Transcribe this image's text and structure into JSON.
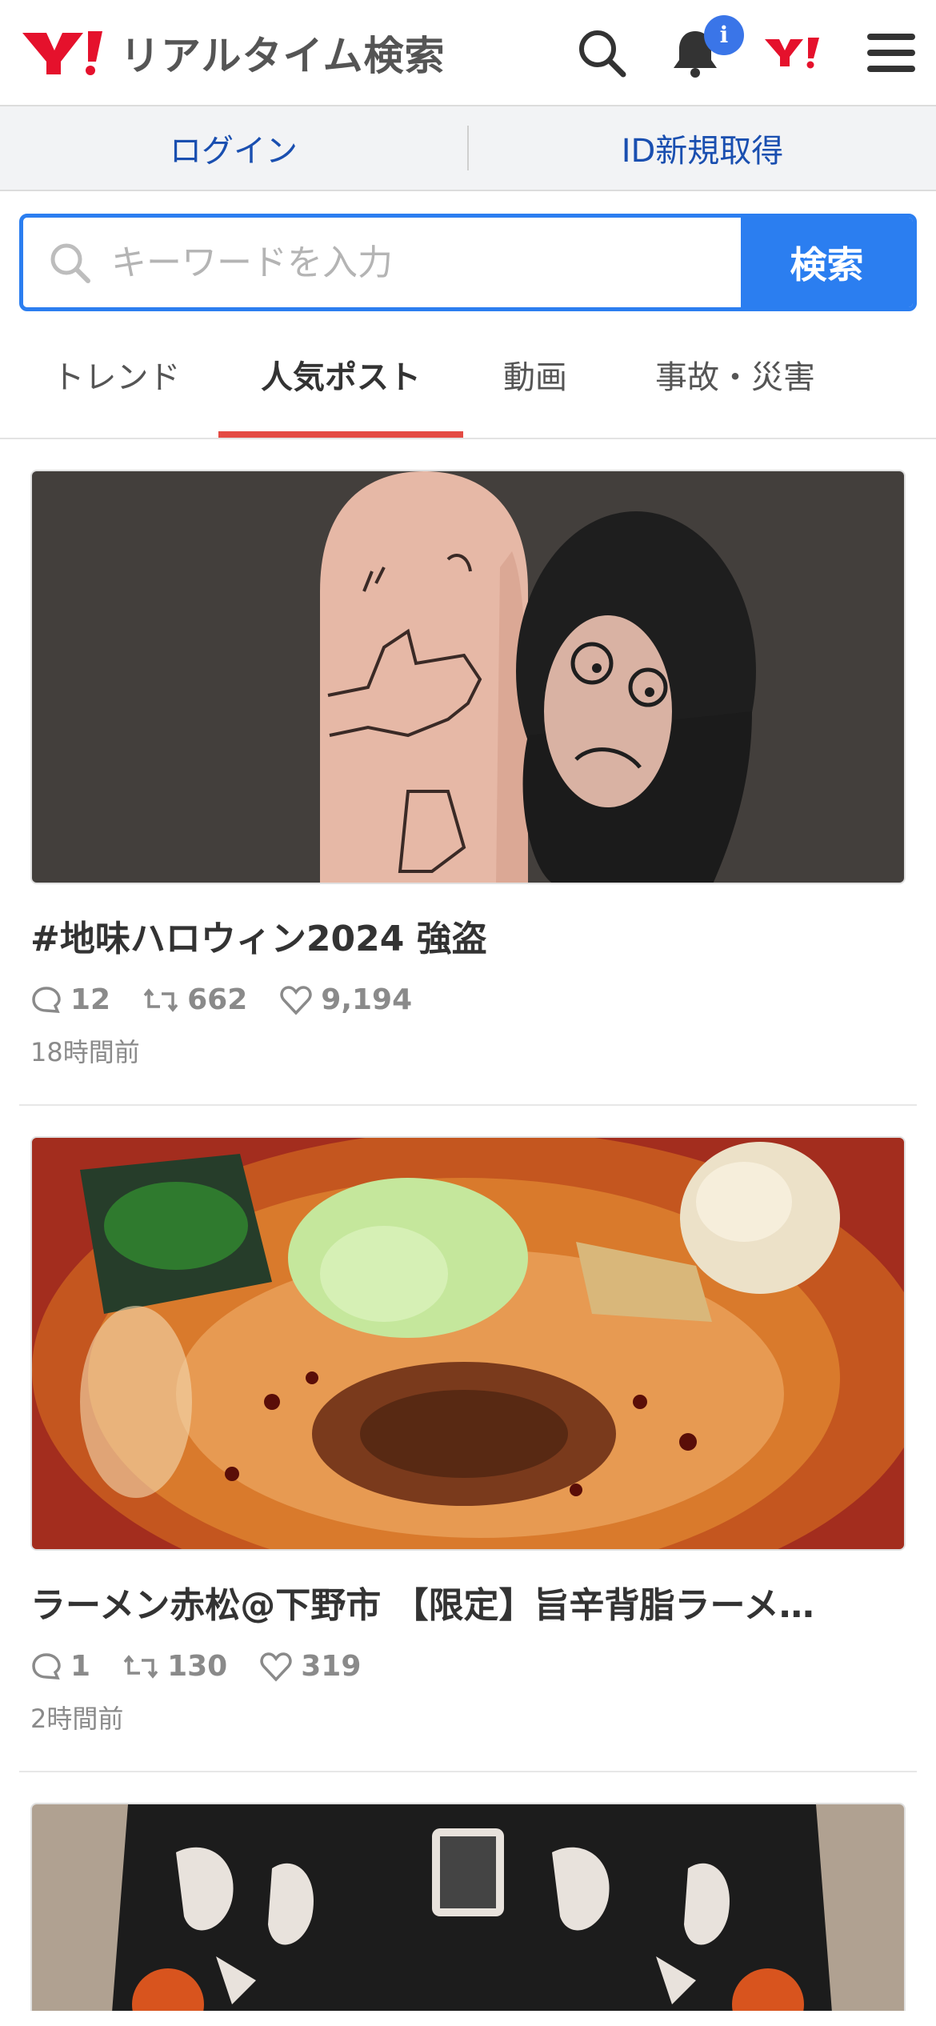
{
  "header": {
    "logo_text": "リアルタイム検索",
    "notification_badge": "i",
    "search_icon": "search-icon",
    "bell_icon": "bell-icon",
    "yahoo_icon": "yahoo-logo-icon",
    "menu_icon": "hamburger-menu-icon"
  },
  "loginbar": {
    "login": "ログイン",
    "register": "ID新規取得"
  },
  "search": {
    "placeholder": "キーワードを入力",
    "button": "検索"
  },
  "tabs": [
    {
      "label": "トレンド",
      "active": false
    },
    {
      "label": "人気ポスト",
      "active": true
    },
    {
      "label": "動画",
      "active": false
    },
    {
      "label": "事故・災害",
      "active": false
    }
  ],
  "posts": [
    {
      "title": "#地味ハロウィン2024 強盗",
      "replies": "12",
      "reposts": "662",
      "likes": "9,194",
      "time": "18時間前"
    },
    {
      "title": "ラーメン赤松@下野市 【限定】旨辛背脂ラーメ…",
      "replies": "1",
      "reposts": "130",
      "likes": "319",
      "time": "2時間前"
    }
  ],
  "colors": {
    "accent": "#2b7ef0",
    "tab_underline": "#e44b44",
    "link": "#1a4fb0",
    "yahoo_red": "#e5112c"
  }
}
